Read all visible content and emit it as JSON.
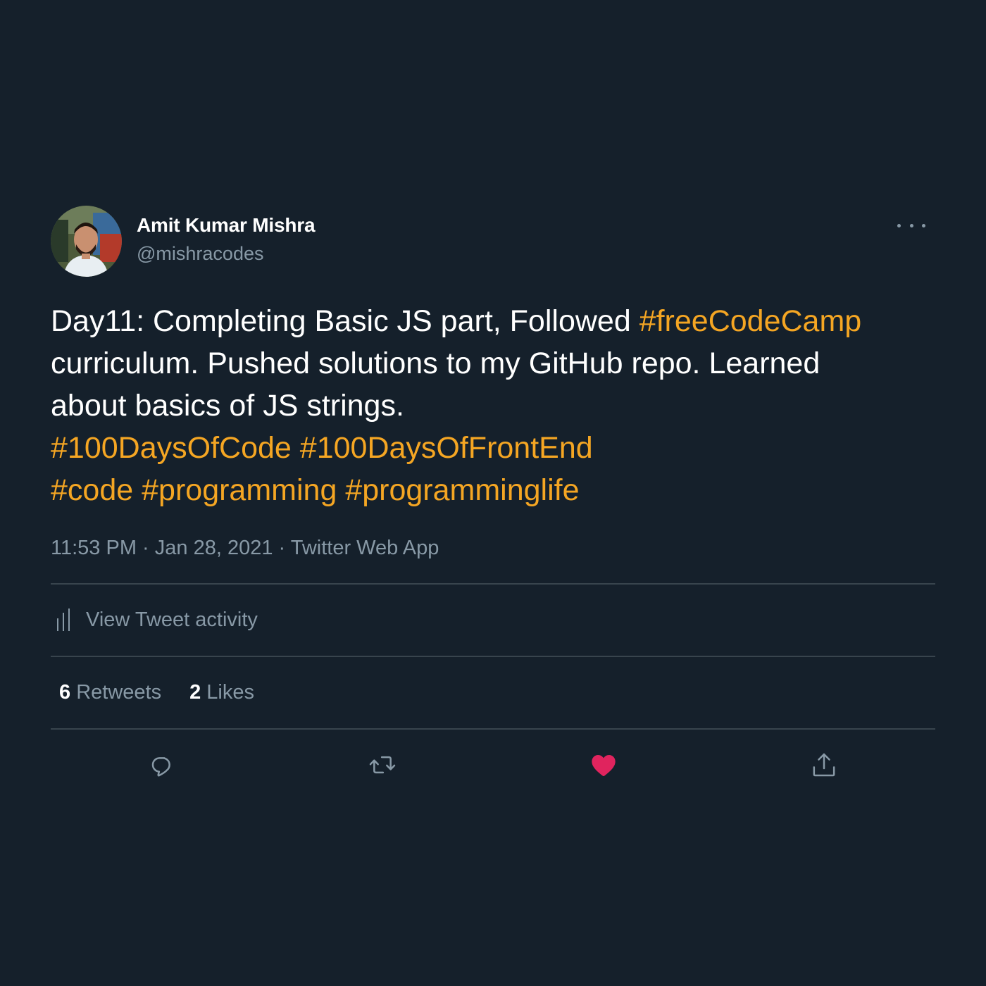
{
  "user": {
    "display_name": "Amit Kumar Mishra",
    "handle": "@mishracodes"
  },
  "tweet": {
    "lines": [
      [
        {
          "text": "Day11: Completing Basic JS part, Followed ",
          "hashtag": false
        },
        {
          "text": "#freeCodeCamp",
          "hashtag": true
        }
      ],
      [
        {
          "text": "curriculum. Pushed solutions to my GitHub repo. Learned",
          "hashtag": false
        }
      ],
      [
        {
          "text": "about basics of JS strings.",
          "hashtag": false
        }
      ],
      [
        {
          "text": "#100DaysOfCode",
          "hashtag": true
        },
        {
          "text": " ",
          "hashtag": false
        },
        {
          "text": "#100DaysOfFrontEnd",
          "hashtag": true
        }
      ],
      [
        {
          "text": "#code",
          "hashtag": true
        },
        {
          "text": " ",
          "hashtag": false
        },
        {
          "text": "#programming",
          "hashtag": true
        },
        {
          "text": " ",
          "hashtag": false
        },
        {
          "text": "#programminglife",
          "hashtag": true
        }
      ]
    ],
    "time": "11:53 PM",
    "separator": " · ",
    "date": "Jan 28, 2021",
    "source": "Twitter Web App"
  },
  "activity": {
    "label": "View Tweet activity",
    "icon": "stats-icon"
  },
  "stats": {
    "retweets_count": "6",
    "retweets_label": "Retweets",
    "likes_count": "2",
    "likes_label": "Likes"
  },
  "actions": [
    {
      "name": "reply",
      "icon": "reply-icon"
    },
    {
      "name": "retweet",
      "icon": "retweet-icon"
    },
    {
      "name": "like",
      "icon": "heart-icon",
      "active": true
    },
    {
      "name": "share",
      "icon": "share-icon"
    }
  ],
  "colors": {
    "background": "#15202b",
    "hashtag": "#f5a623",
    "secondary_text": "#8899a6",
    "divider": "#38444d",
    "like_active": "#e0245e"
  }
}
